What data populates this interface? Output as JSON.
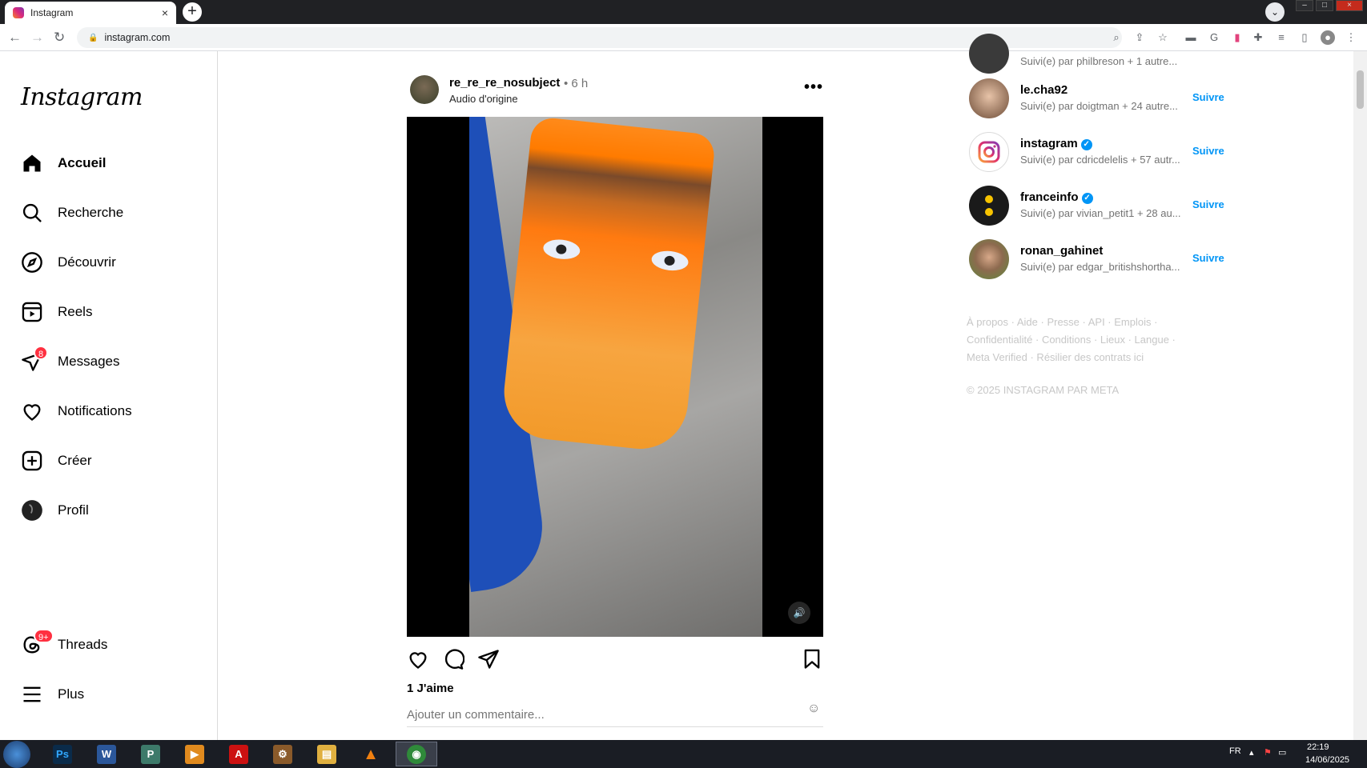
{
  "browser": {
    "tab_title": "Instagram",
    "tab_close": "×",
    "new_tab": "+",
    "tab_search": "⌄",
    "url": "instagram.com",
    "back": "←",
    "forward": "→",
    "reload": "↻",
    "minimize": "–",
    "restore": "□",
    "close": "×"
  },
  "sidebar": {
    "logo": "Instagram",
    "items": [
      {
        "label": "Accueil"
      },
      {
        "label": "Recherche"
      },
      {
        "label": "Découvrir"
      },
      {
        "label": "Reels"
      },
      {
        "label": "Messages",
        "badge": "8"
      },
      {
        "label": "Notifications"
      },
      {
        "label": "Créer"
      },
      {
        "label": "Profil"
      },
      {
        "label": "Threads",
        "badge": "9+"
      },
      {
        "label": "Plus"
      }
    ]
  },
  "post": {
    "username": "re_re_re_nosubject",
    "time": "• 6 h",
    "audio": "Audio d'origine",
    "more": "•••",
    "likes": "1 J'aime",
    "comment_placeholder": "Ajouter un commentaire...",
    "emoji": "☺",
    "sound": "🔊"
  },
  "suggestions": [
    {
      "username": "",
      "subtitle": "Suivi(e) par philbreson + 1 autre...",
      "follow": ""
    },
    {
      "username": "le.cha92",
      "subtitle": "Suivi(e) par doigtman + 24 autre...",
      "follow": "Suivre"
    },
    {
      "username": "instagram",
      "verified": "✓",
      "subtitle": "Suivi(e) par cdricdelelis + 57 autr...",
      "follow": "Suivre"
    },
    {
      "username": "franceinfo",
      "verified": "✓",
      "subtitle": "Suivi(e) par vivian_petit1 + 28 au...",
      "follow": "Suivre"
    },
    {
      "username": "ronan_gahinet",
      "subtitle": "Suivi(e) par edgar_britishshortha...",
      "follow": "Suivre"
    }
  ],
  "footer": {
    "links_line1": "À propos · Aide · Presse · API · Emplois ·",
    "links_line2": "Confidentialité · Conditions · Lieux · Langue ·",
    "links_line3": "Meta Verified · Résilier des contrats ici",
    "copyright": "© 2025 INSTAGRAM PAR META"
  },
  "taskbar": {
    "apps": [
      {
        "name": "photoshop",
        "glyph": "Ps",
        "color": "#0a2b4a"
      },
      {
        "name": "word",
        "glyph": "W",
        "color": "#2b579a"
      },
      {
        "name": "publisher",
        "glyph": "P",
        "color": "#3d7a6a"
      },
      {
        "name": "media-player",
        "glyph": "▶",
        "color": "#e08a1e"
      },
      {
        "name": "acrobat",
        "glyph": "A",
        "color": "#c11"
      },
      {
        "name": "tool",
        "glyph": "⚙",
        "color": "#8a5a2a"
      },
      {
        "name": "explorer",
        "glyph": "▤",
        "color": "#e0b040"
      },
      {
        "name": "vlc",
        "glyph": "▲",
        "color": "#f08010"
      },
      {
        "name": "chrome",
        "glyph": "◉",
        "color": "#2f8a3a"
      }
    ],
    "lang": "FR",
    "time": "22:19",
    "date": "14/06/2025"
  }
}
